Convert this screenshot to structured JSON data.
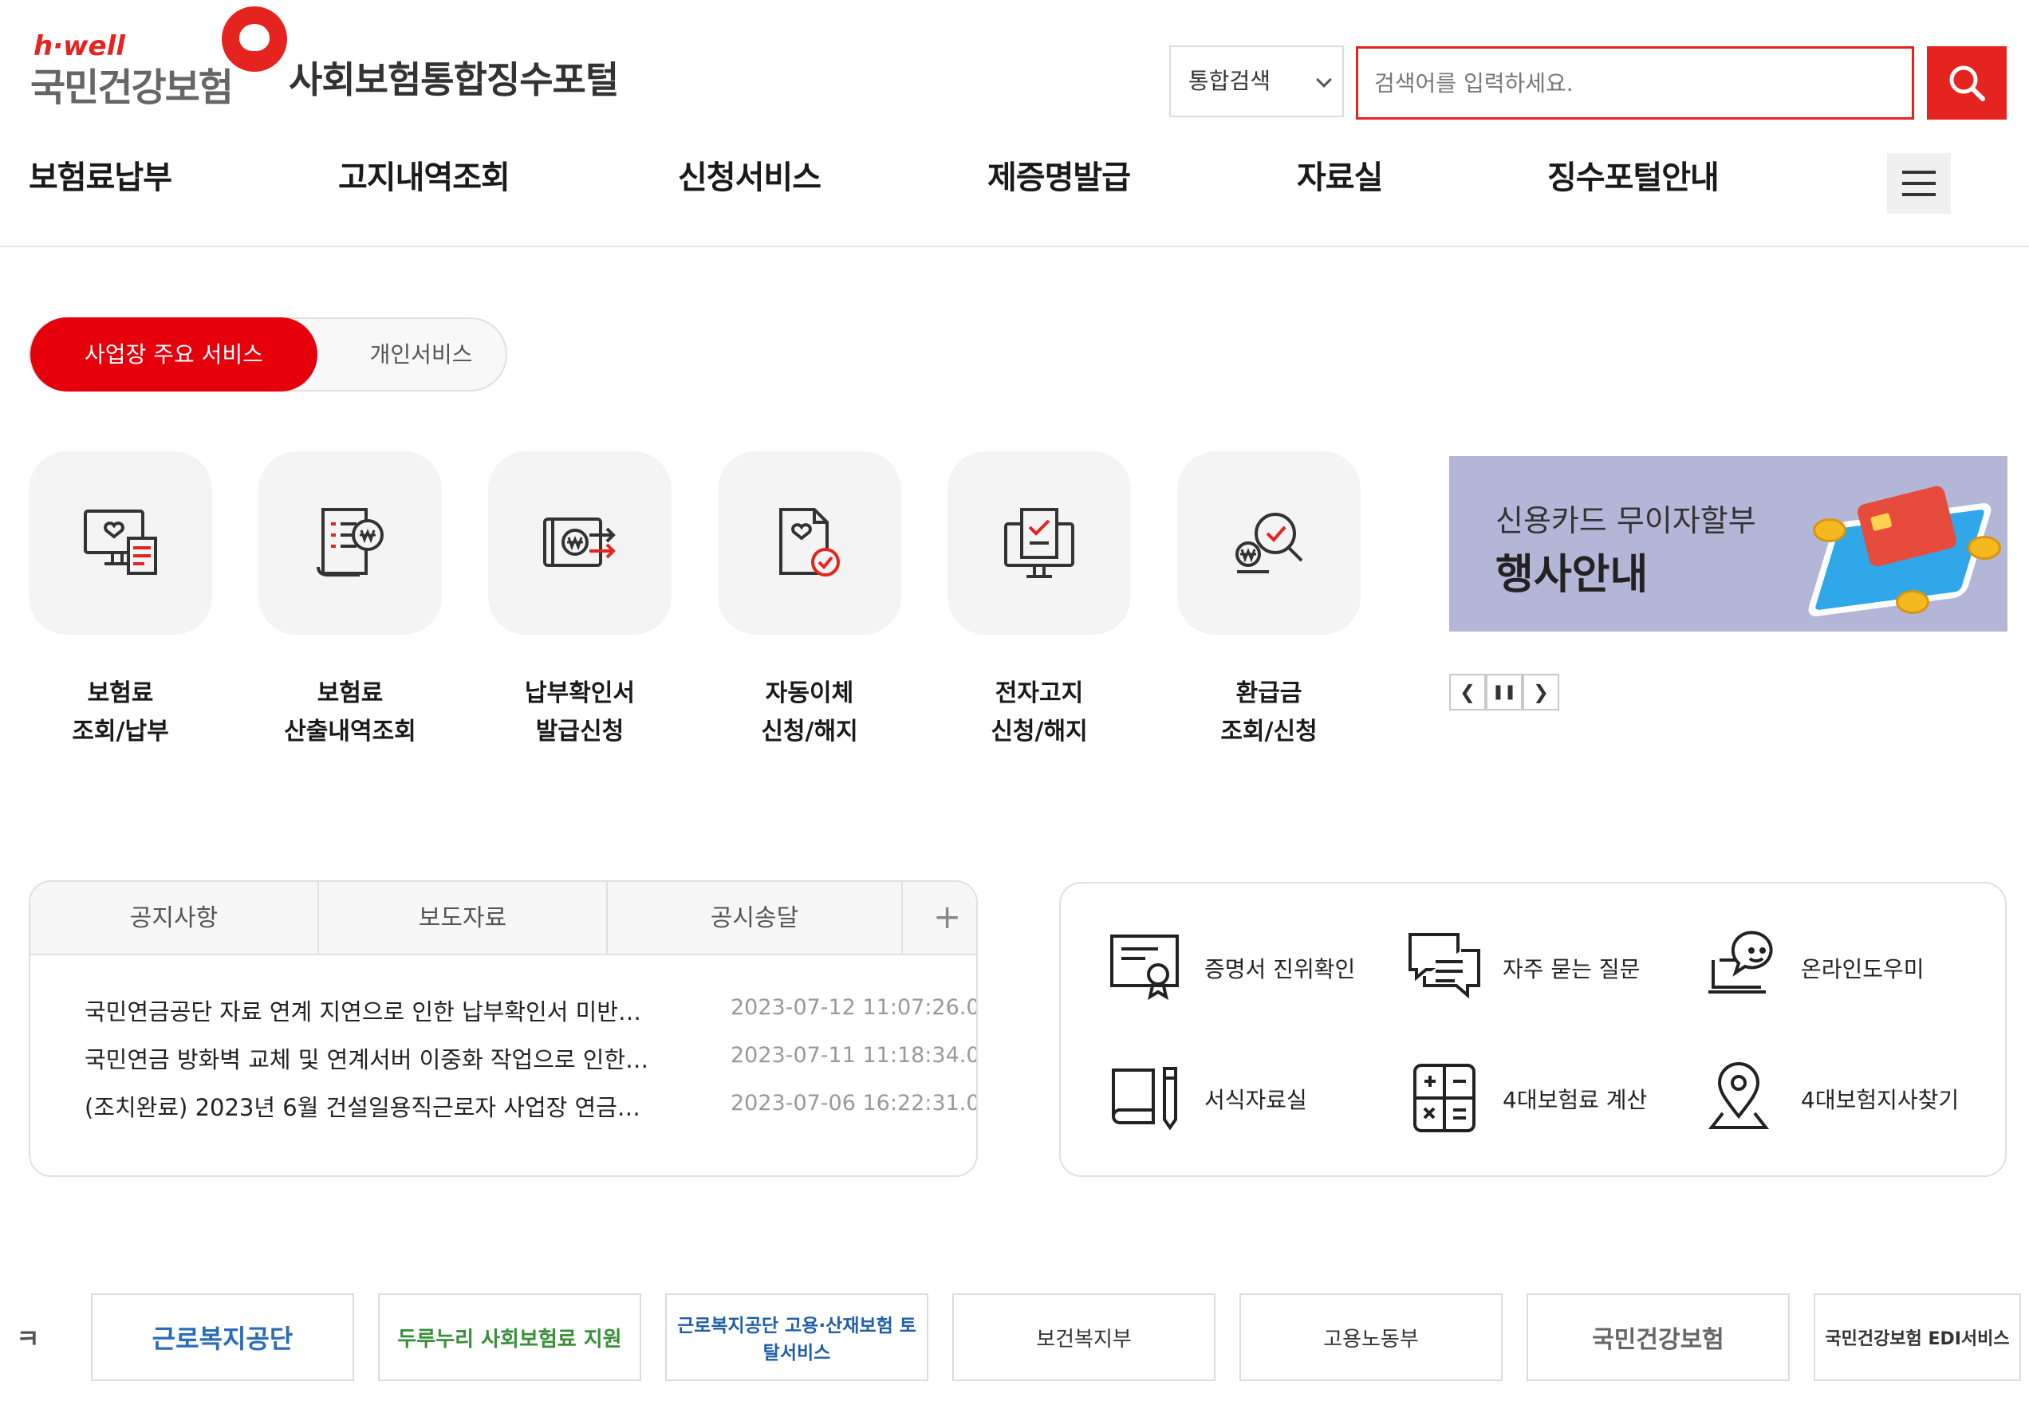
{
  "header": {
    "logo_brand": "h·well",
    "logo_name": "국민건강보험",
    "portal_title": "사회보험통합징수포털",
    "search_select_value": "통합검색",
    "search_placeholder": "검색어를 입력하세요."
  },
  "gnb": {
    "items": [
      {
        "label": "보험료납부"
      },
      {
        "label": "고지내역조회"
      },
      {
        "label": "신청서비스"
      },
      {
        "label": "제증명발급"
      },
      {
        "label": "자료실"
      },
      {
        "label": "징수포털안내"
      }
    ]
  },
  "service_tabs": {
    "active": "사업장 주요 서비스",
    "inactive": "개인서비스"
  },
  "quick_services": [
    {
      "line1": "보험료",
      "line2": "조회/납부",
      "icon": "monitor-receipt-icon"
    },
    {
      "line1": "보험료",
      "line2": "산출내역조회",
      "icon": "document-won-icon"
    },
    {
      "line1": "납부확인서",
      "line2": "발급신청",
      "icon": "wallet-transfer-icon"
    },
    {
      "line1": "자동이체",
      "line2": "신청/해지",
      "icon": "document-check-icon"
    },
    {
      "line1": "전자고지",
      "line2": "신청/해지",
      "icon": "computer-check-icon"
    },
    {
      "line1": "환급금",
      "line2": "조회/신청",
      "icon": "search-check-icon"
    }
  ],
  "banner": {
    "sub": "신용카드 무이자할부",
    "main": "행사안내",
    "accent": "#e5231f"
  },
  "notice": {
    "tabs": [
      "공지사항",
      "보도자료",
      "공시송달"
    ],
    "rows": [
      {
        "title": "국민연금공단 자료 연계 지연으로 인한 납부확인서 미반…",
        "date": "2023-07-12 11:07:26.0"
      },
      {
        "title": "국민연금 방화벽 교체 및 연계서버 이중화 작업으로 인한…",
        "date": "2023-07-11 11:18:34.0"
      },
      {
        "title": "(조치완료) 2023년 6월 건설일용직근로자 사업장 연금…",
        "date": "2023-07-06 16:22:31.0"
      }
    ]
  },
  "links": [
    {
      "label": "증명서 진위확인",
      "icon": "certificate-icon"
    },
    {
      "label": "자주 묻는 질문",
      "icon": "chat-icon"
    },
    {
      "label": "온라인도우미",
      "icon": "online-helper-icon"
    },
    {
      "label": "서식자료실",
      "icon": "book-pen-icon"
    },
    {
      "label": "4대보험료 계산",
      "icon": "calculator-icon"
    },
    {
      "label": "4대보험지사찾기",
      "icon": "location-pin-icon"
    }
  ],
  "family_sites": [
    "ㅋ",
    "근로복지공단",
    "두루누리 사회보험료 지원",
    "근로복지공단 고용·산재보험 토탈서비스",
    "보건복지부",
    "고용노동부",
    "국민건강보험",
    "국민건강보험 EDI서비스"
  ]
}
